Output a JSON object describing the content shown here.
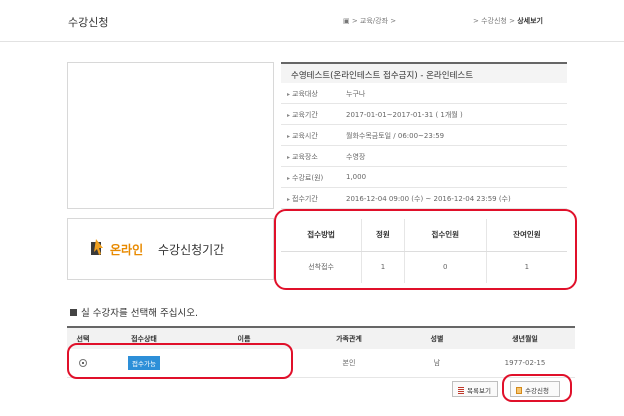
{
  "header": {
    "title": "수강신청",
    "breadcrumb_home": "▣ > 교육/강좌 >",
    "breadcrumb_path": "> 수강신청 >",
    "breadcrumb_current": "상세보기"
  },
  "course": {
    "title": "수영테스트(온라인테스트 접수금지) - 온라인테스트",
    "info": [
      {
        "label": "교육대상",
        "value": "누구나"
      },
      {
        "label": "교육기간",
        "value": "2017-01-01~2017-01-31 ( 1개월 )"
      },
      {
        "label": "교육시간",
        "value": "월화수목금토일 / 06:00~23:59"
      },
      {
        "label": "교육장소",
        "value": "수영장"
      },
      {
        "label": "수강료(원)",
        "value": "1,000"
      },
      {
        "label": "접수기간",
        "value": "2016-12-04 09:00 (수) ~ 2016-12-04 23:59 (수)"
      }
    ]
  },
  "banner": {
    "online": "온라인",
    "rest": "수강신청기간"
  },
  "stats": {
    "headers": [
      "접수방법",
      "정원",
      "접수인원",
      "잔여인원"
    ],
    "row": [
      "선착접수",
      "1",
      "0",
      "1"
    ]
  },
  "applicants": {
    "heading": "실 수강자를 선택해 주십시오.",
    "headers": [
      "선택",
      "접수상태",
      "이름",
      "가족관계",
      "성별",
      "생년월일"
    ],
    "row": {
      "status": "접수가능",
      "name": "",
      "relation": "본인",
      "gender": "남",
      "birth": "1977-02-15"
    }
  },
  "buttons": {
    "list": "목록보기",
    "apply": "수강신청"
  },
  "colors": {
    "highlight": "#e0102a",
    "badge": "#2d8fd8",
    "online_accent": "#e88a00"
  }
}
